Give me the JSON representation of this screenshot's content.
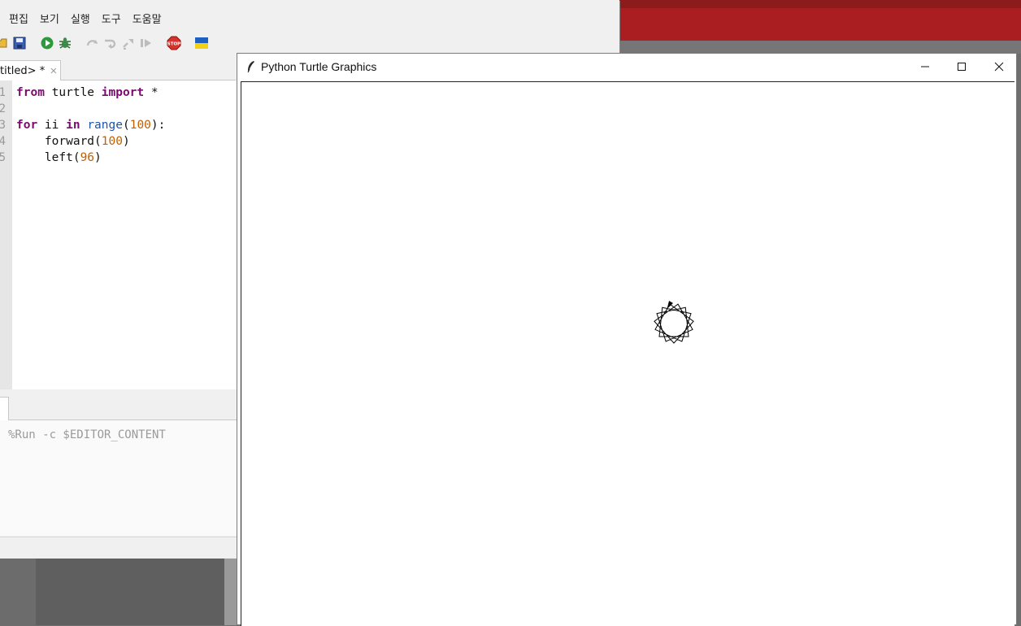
{
  "thonny": {
    "menu": [
      "편집",
      "보기",
      "실행",
      "도구",
      "도움말"
    ],
    "editor_tab": {
      "label": "titled> *",
      "close_icon": "close-icon"
    },
    "gutter": [
      "1",
      "2",
      "3",
      "4",
      "5"
    ],
    "code": {
      "l1_kw1": "from",
      "l1_mod": " turtle ",
      "l1_kw2": "import",
      "l1_rest": " *",
      "l3_kw1": "for",
      "l3_var": " ii ",
      "l3_kw2": "in",
      "l3_sp": " ",
      "l3_fn": "range",
      "l3_open": "(",
      "l3_num": "100",
      "l3_close": "):",
      "l4_fn": "    forward(",
      "l4_num": "100",
      "l4_close": ")",
      "l5_fn": "    left(",
      "l5_num": "96",
      "l5_close": ")"
    },
    "shell_line": "%Run -c $EDITOR_CONTENT"
  },
  "turtle_window": {
    "title": "Python Turtle Graphics",
    "icon": "feather-icon"
  },
  "colors": {
    "keyword": "#7a0a6e",
    "builtin": "#1a55a8",
    "number": "#c06000",
    "desktop_red": "#aa1e22"
  }
}
